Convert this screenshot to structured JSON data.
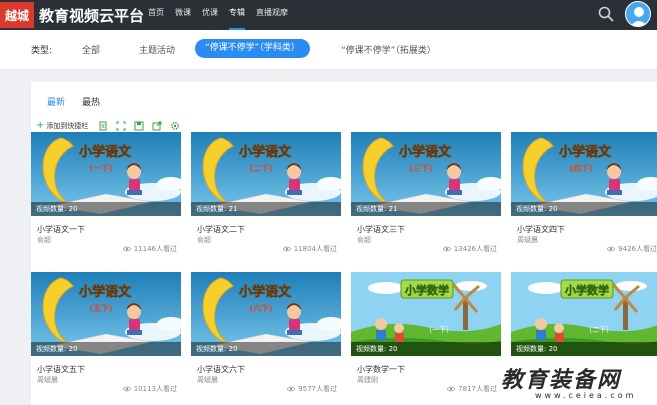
{
  "header": {
    "logo_badge": "越城",
    "site_title": "教育视频云平台",
    "nav": [
      "首页",
      "微课",
      "优课",
      "专辑",
      "直播观摩"
    ],
    "active_nav": 3
  },
  "filter": {
    "label": "类型:",
    "options": [
      "全部",
      "主题活动",
      "“停课不停学”（学科类）",
      "“停课不停学”（拓展类）"
    ],
    "active": 2
  },
  "sort": {
    "tabs": [
      "最新",
      "最热"
    ],
    "active": 0
  },
  "toolbar": {
    "add_label": "添加到快捷栏"
  },
  "colors": {
    "accent": "#2a8cf0",
    "header_bg": "#2b2f36",
    "logo_red": "#d93a2b"
  },
  "cards": [
    {
      "banner": "小学语文",
      "grade": "一下",
      "count": "视频数量: 20",
      "title": "小学语文一下",
      "author": "俞超",
      "views": "11146人看过",
      "theme": "moon"
    },
    {
      "banner": "小学语文",
      "grade": "二下",
      "count": "视频数量: 21",
      "title": "小学语文二下",
      "author": "俞超",
      "views": "11804人看过",
      "theme": "moon"
    },
    {
      "banner": "小学语文",
      "grade": "三下",
      "count": "视频数量: 21",
      "title": "小学语文三下",
      "author": "俞超",
      "views": "13426人看过",
      "theme": "moon"
    },
    {
      "banner": "小学语文",
      "grade": "四下",
      "count": "视频数量: 20",
      "title": "小学语文四下",
      "author": "周斌晨",
      "views": "9426人看过",
      "theme": "moon"
    },
    {
      "banner": "小学语文",
      "grade": "五下",
      "count": "视频数量: 20",
      "title": "小学语文五下",
      "author": "周斌晨",
      "views": "10113人看过",
      "theme": "moon"
    },
    {
      "banner": "小学语文",
      "grade": "六下",
      "count": "视频数量: 20",
      "title": "小学语文六下",
      "author": "周斌晨",
      "views": "9577人看过",
      "theme": "moon"
    },
    {
      "banner": "小学数学",
      "grade": "一下",
      "count": "视频数量: 20",
      "title": "小学数学一下",
      "author": "周建刚",
      "views": "7817人看过",
      "theme": "field"
    },
    {
      "banner": "小学数学",
      "grade": "二下",
      "count": "视频数量: 20",
      "title": "",
      "author": "",
      "views": "",
      "theme": "field"
    }
  ],
  "watermark": {
    "text": "教育装备网",
    "sub": "www.ceiea.com"
  }
}
